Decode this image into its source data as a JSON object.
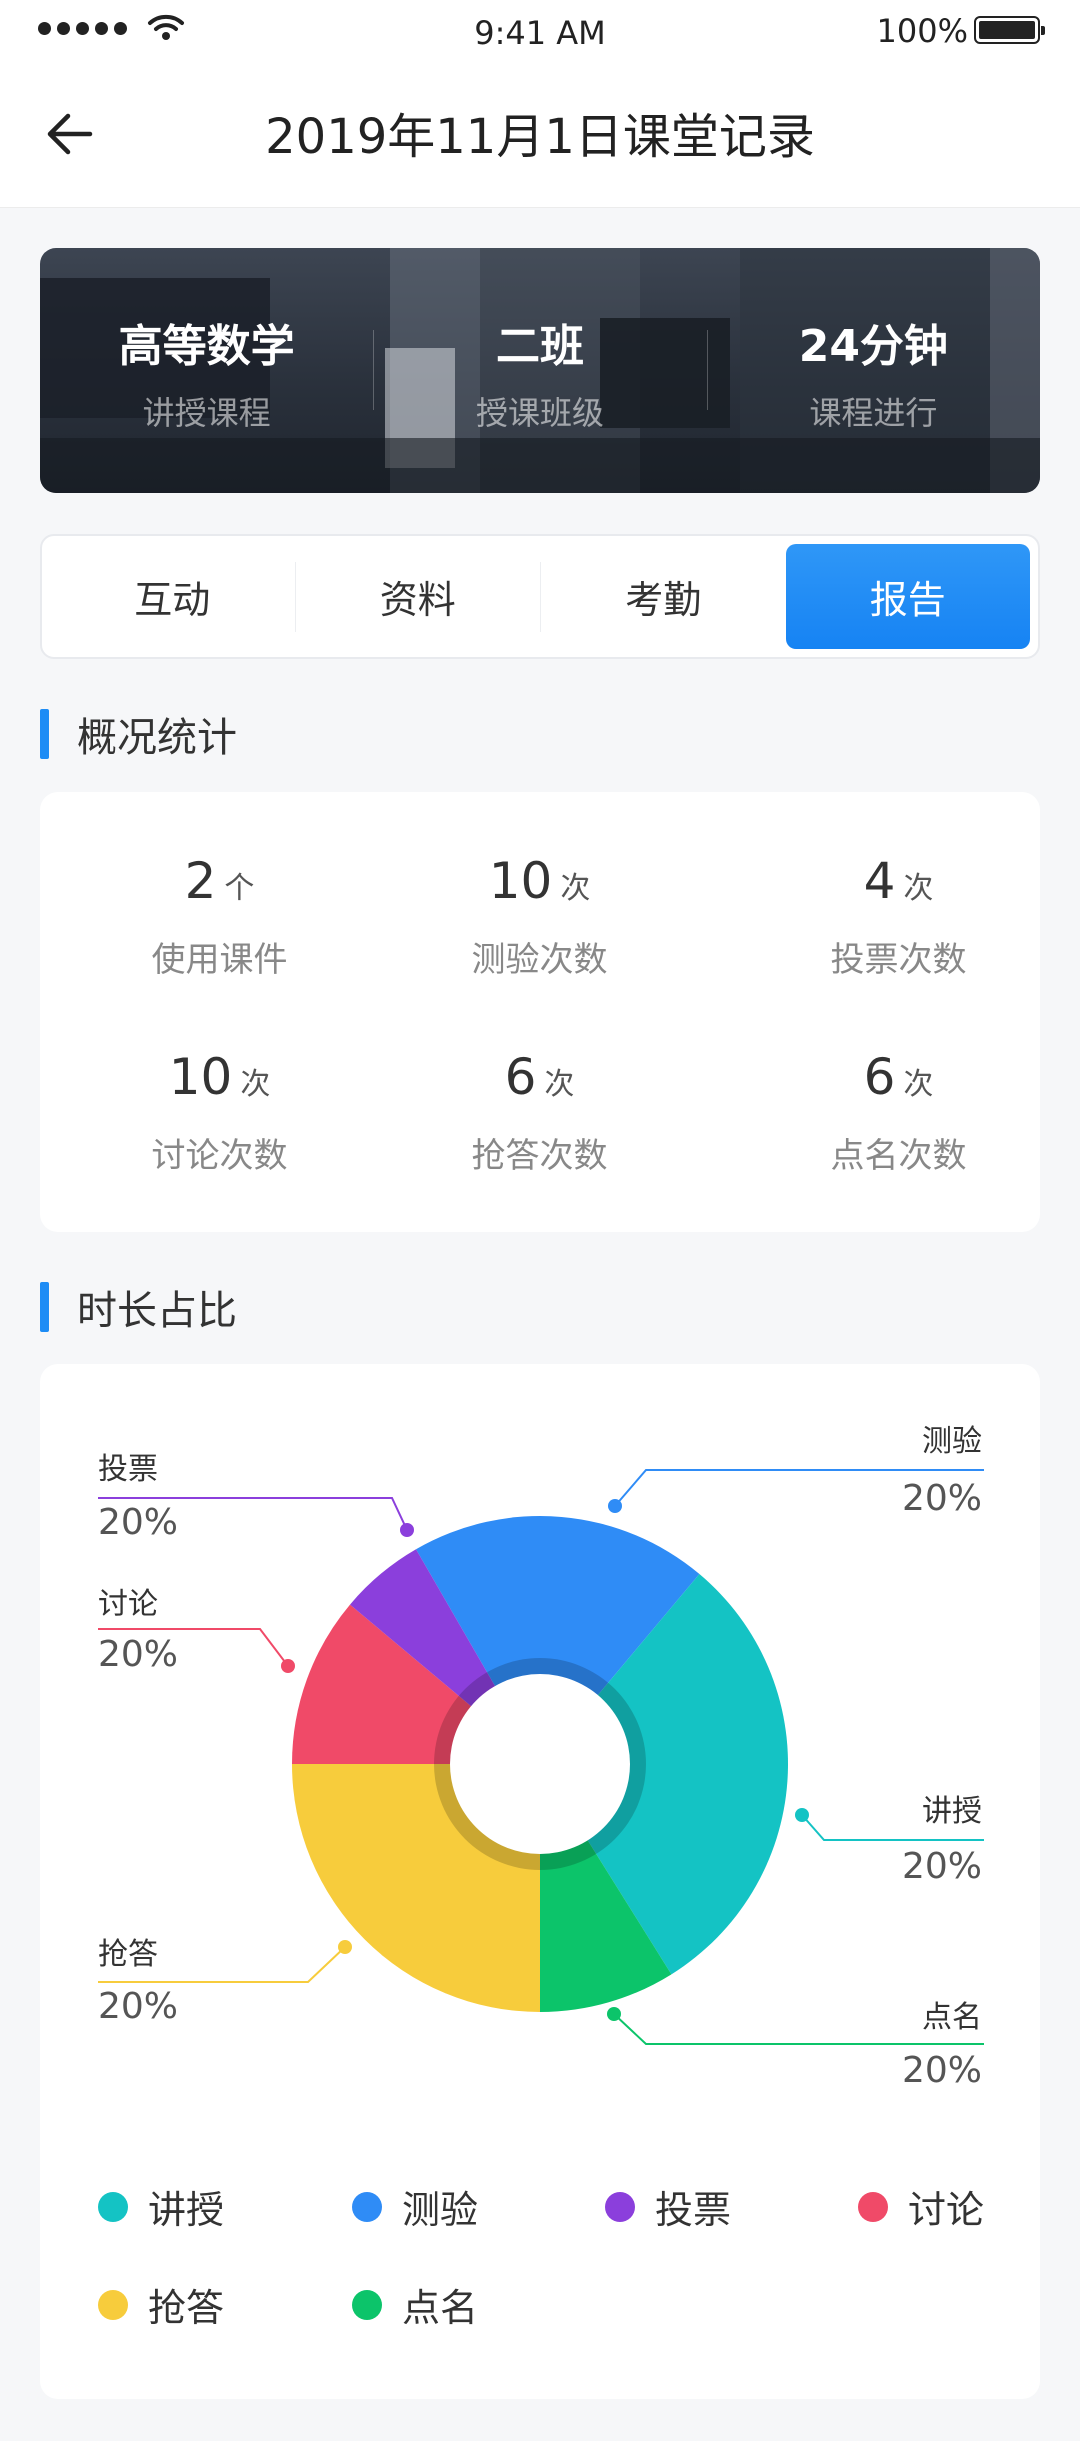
{
  "status_bar": {
    "time": "9:41 AM",
    "battery": "100%"
  },
  "nav": {
    "title": "2019年11月1日课堂记录"
  },
  "banner": {
    "cells": [
      {
        "value": "高等数学",
        "label": "讲授课程"
      },
      {
        "value": "二班",
        "label": "授课班级"
      },
      {
        "value": "24分钟",
        "label": "课程进行"
      }
    ]
  },
  "tabs": [
    {
      "label": "互动",
      "active": false
    },
    {
      "label": "资料",
      "active": false
    },
    {
      "label": "考勤",
      "active": false
    },
    {
      "label": "报告",
      "active": true
    }
  ],
  "overview": {
    "title": "概况统计",
    "stats": [
      {
        "value": "2",
        "unit": "个",
        "label": "使用课件"
      },
      {
        "value": "10",
        "unit": "次",
        "label": "测验次数"
      },
      {
        "value": "4",
        "unit": "次",
        "label": "投票次数"
      },
      {
        "value": "10",
        "unit": "次",
        "label": "讨论次数"
      },
      {
        "value": "6",
        "unit": "次",
        "label": "抢答次数"
      },
      {
        "value": "6",
        "unit": "次",
        "label": "点名次数"
      }
    ]
  },
  "duration": {
    "title": "时长占比",
    "colors": {
      "lecture": "#14c3c4",
      "quiz": "#2f8cf6",
      "vote": "#8b3fdc",
      "discussion": "#f04a68",
      "rush": "#f7cc3c",
      "rollcall": "#0cc46a"
    },
    "callouts": [
      {
        "name": "投票",
        "pct": "20%"
      },
      {
        "name": "讨论",
        "pct": "20%"
      },
      {
        "name": "抢答",
        "pct": "20%"
      },
      {
        "name": "测验",
        "pct": "20%"
      },
      {
        "name": "讲授",
        "pct": "20%"
      },
      {
        "name": "点名",
        "pct": "20%"
      }
    ],
    "legend": [
      {
        "label": "讲授",
        "color": "#14c3c4"
      },
      {
        "label": "测验",
        "color": "#2f8cf6"
      },
      {
        "label": "投票",
        "color": "#8b3fdc"
      },
      {
        "label": "讨论",
        "color": "#f04a68"
      },
      {
        "label": "抢答",
        "color": "#f7cc3c"
      },
      {
        "label": "点名",
        "color": "#0cc46a"
      }
    ]
  },
  "chart_data": {
    "type": "pie",
    "donut": true,
    "categories": [
      "讲授",
      "测验",
      "投票",
      "讨论",
      "抢答",
      "点名"
    ],
    "values": [
      20,
      20,
      20,
      20,
      20,
      20
    ],
    "value_labels": [
      "20%",
      "20%",
      "20%",
      "20%",
      "20%",
      "20%"
    ],
    "title": "时长占比",
    "legend": "bottom"
  }
}
